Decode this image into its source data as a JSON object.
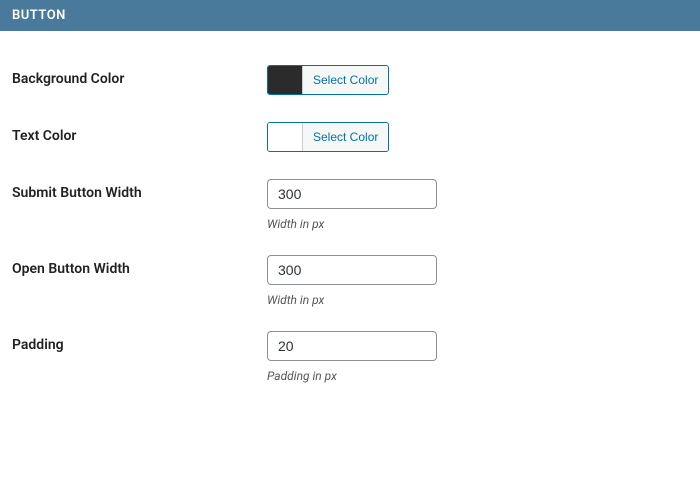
{
  "section": {
    "title": "BUTTON"
  },
  "fields": {
    "bg_color": {
      "label": "Background Color",
      "button_text": "Select Color",
      "swatch": "#2b2b2b"
    },
    "text_color": {
      "label": "Text Color",
      "button_text": "Select Color",
      "swatch": "#ffffff"
    },
    "submit_width": {
      "label": "Submit Button Width",
      "value": "300",
      "hint": "Width in px"
    },
    "open_width": {
      "label": "Open Button Width",
      "value": "300",
      "hint": "Width in px"
    },
    "padding": {
      "label": "Padding",
      "value": "20",
      "hint": "Padding in px"
    }
  }
}
